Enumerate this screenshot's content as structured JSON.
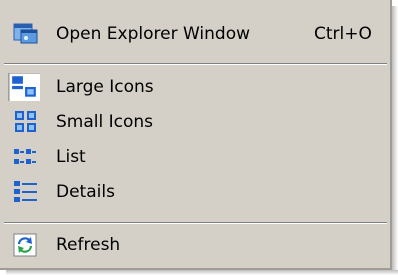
{
  "menu": {
    "items": [
      {
        "label": "Open Explorer Window",
        "shortcut": "Ctrl+O",
        "icon": "explorer-window-icon"
      },
      {
        "label": "Large Icons",
        "icon": "large-icons-icon"
      },
      {
        "label": "Small Icons",
        "icon": "small-icons-icon"
      },
      {
        "label": "List",
        "icon": "list-icon"
      },
      {
        "label": "Details",
        "icon": "details-icon"
      },
      {
        "label": "Refresh",
        "icon": "refresh-icon"
      }
    ]
  },
  "colors": {
    "menu_background": "#d4d0c8",
    "icon_blue": "#1e62d0",
    "refresh_green": "#2aa44a"
  }
}
